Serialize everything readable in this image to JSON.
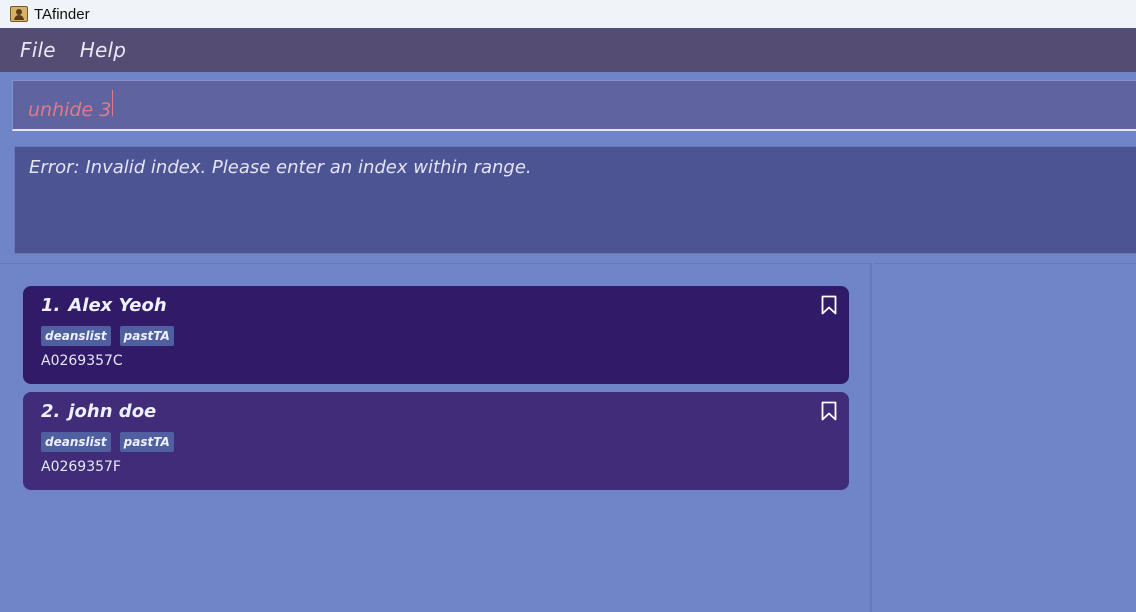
{
  "window": {
    "title": "TAfinder",
    "icon": "contact-book-icon"
  },
  "menu": {
    "items": [
      "File",
      "Help"
    ]
  },
  "command": {
    "value": "unhide 3"
  },
  "result": {
    "message": "Error: Invalid index. Please enter an index within range."
  },
  "persons": [
    {
      "index": "1.",
      "name": "Alex Yeoh",
      "tags": [
        "deanslist",
        "pastTA"
      ],
      "id": "A0269357C",
      "icon": "bookmark-icon"
    },
    {
      "index": "2.",
      "name": "john doe",
      "tags": [
        "deanslist",
        "pastTA"
      ],
      "id": "A0269357F",
      "icon": "bookmark-icon"
    }
  ],
  "colors": {
    "background": "#6f85c7",
    "menubar": "#544c72",
    "card1": "#311b69",
    "card2": "#412c7a",
    "command_text": "#e07a86"
  }
}
